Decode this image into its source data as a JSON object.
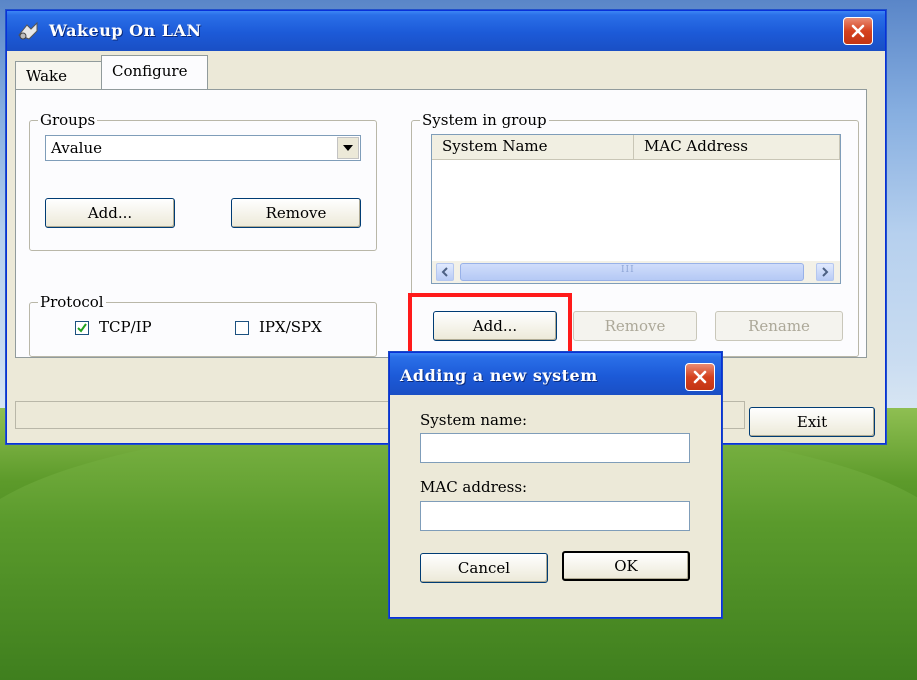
{
  "main_window": {
    "title": "Wakeup On LAN",
    "tabs": [
      {
        "label": "Wake"
      },
      {
        "label": "Configure"
      }
    ],
    "groups": {
      "legend": "Groups",
      "selected": "Avalue",
      "add_label": "Add...",
      "remove_label": "Remove"
    },
    "protocol": {
      "legend": "Protocol",
      "tcpip": {
        "label": "TCP/IP",
        "checked": true
      },
      "ipxspx": {
        "label": "IPX/SPX",
        "checked": false
      }
    },
    "system_in_group": {
      "legend": "System in group",
      "columns": [
        "System Name",
        "MAC Address"
      ],
      "scroll_grip": "III",
      "add_label": "Add...",
      "remove_label": "Remove",
      "rename_label": "Rename"
    },
    "exit_label": "Exit"
  },
  "dialog": {
    "title": "Adding a new system",
    "system_name_label": "System name:",
    "system_name_value": "",
    "mac_label": "MAC address:",
    "mac_value": "",
    "cancel_label": "Cancel",
    "ok_label": "OK"
  },
  "colors": {
    "titlebar": "#1c5ad8",
    "window_bg": "#ece9d8",
    "highlight": "#ff1a1a",
    "close_button": "#d5421f"
  }
}
